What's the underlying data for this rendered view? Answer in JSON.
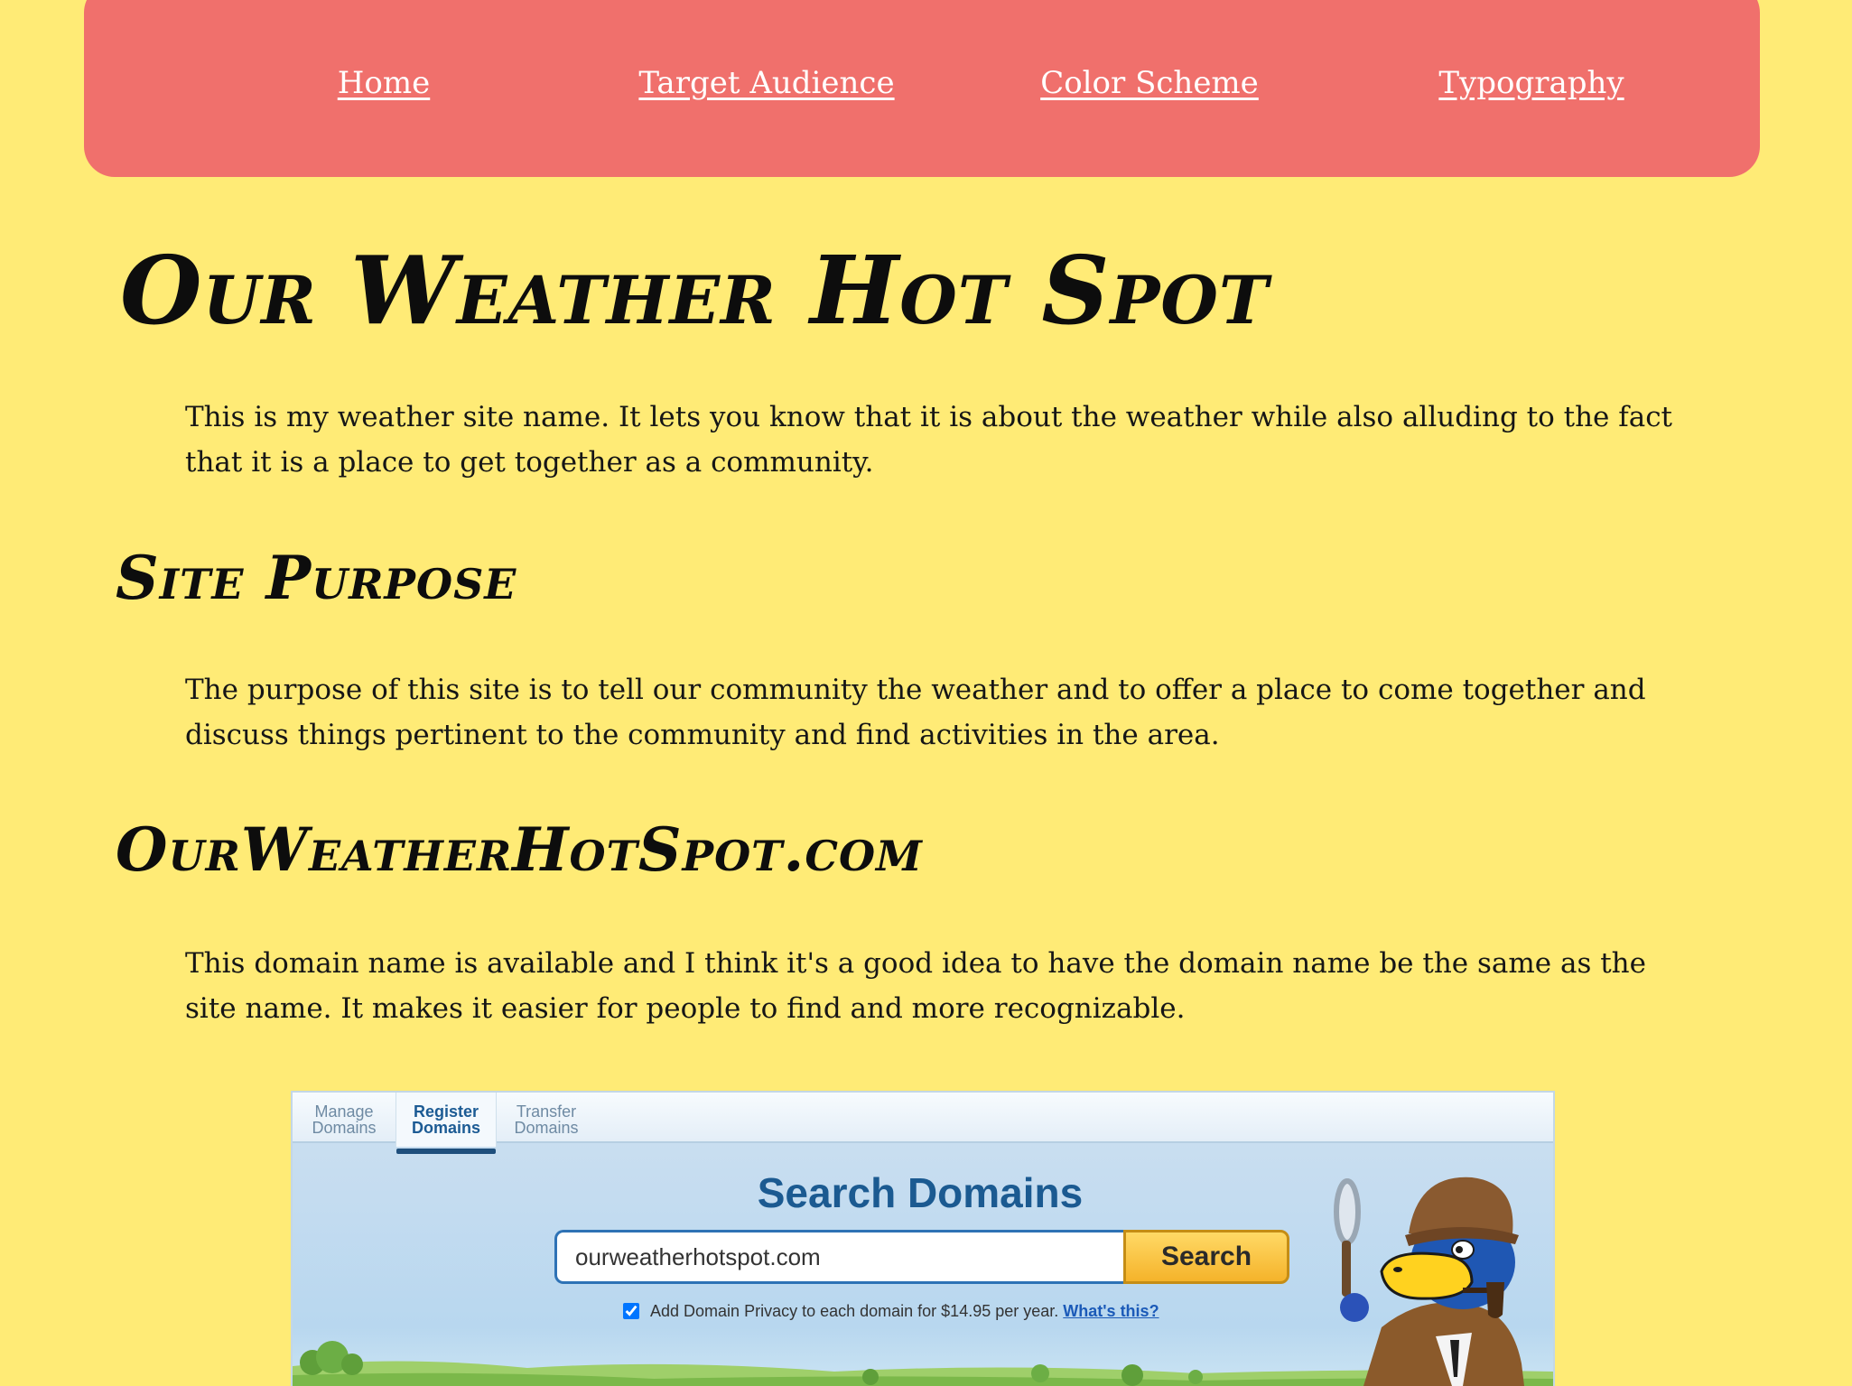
{
  "nav": {
    "items": [
      {
        "label": "Home"
      },
      {
        "label": "Target Audience"
      },
      {
        "label": "Color Scheme"
      },
      {
        "label": "Typography"
      }
    ]
  },
  "main": {
    "title": "Our Weather Hot Spot",
    "intro": "This is my weather site name. It lets you know that it is about the weather while also alluding to the fact that it is a place to get together as a community.",
    "sections": [
      {
        "heading": "Site Purpose",
        "text": "The purpose of this site is to tell our community the weather and to offer a place to come together and discuss things pertinent to the community and find activities in the area."
      },
      {
        "heading": "OurWeatherHotSpot.com",
        "text": "This domain name is available and I think it's a good idea to have the domain name be the same as the site name. It makes it easier for people to find and more recognizable."
      }
    ]
  },
  "domain_shot": {
    "tabs": [
      {
        "line1": "Manage",
        "line2": "Domains"
      },
      {
        "line1": "Register",
        "line2": "Domains"
      },
      {
        "line1": "Transfer",
        "line2": "Domains"
      }
    ],
    "title": "Search Domains",
    "search_value": "ourweatherhotspot.com",
    "search_button": "Search",
    "privacy_text": "Add Domain Privacy to each domain for $14.95 per year.",
    "privacy_link": "What's this?",
    "colors": {
      "accent_blue": "#1b5a91",
      "button_gold": "#f5b32a",
      "nav_bg": "#f0706c",
      "page_bg": "#ffeb76"
    }
  }
}
